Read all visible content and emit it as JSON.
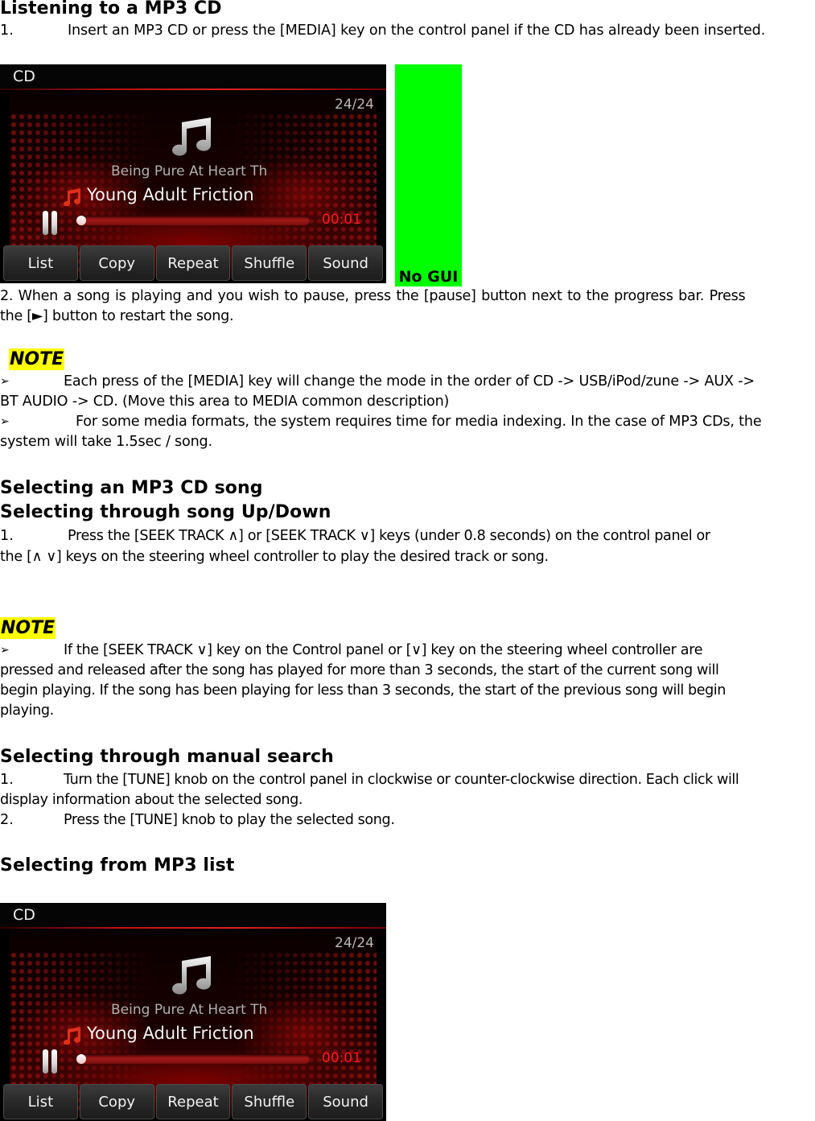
{
  "section1": {
    "heading": "Listening to a MP3 CD",
    "step1_num": "1.",
    "step1_text": "Insert an MP3 CD or press the [MEDIA] key on the control panel if the CD has already been inserted."
  },
  "screen": {
    "source_label": "CD",
    "track_count": "24/24",
    "artist": "Being Pure At Heart Th",
    "title": "Young Adult Friction",
    "elapsed": "00:01",
    "progress_fraction": 0.01,
    "buttons": [
      "List",
      "Copy",
      "Repeat",
      "Shuffle",
      "Sound"
    ],
    "colors": {
      "accent": "#e02020",
      "elapsed_text": "#ff1a1a",
      "note_icon": "#e0301a"
    }
  },
  "placeholder": {
    "label": "No GUI",
    "color": "#00ff00"
  },
  "step2": {
    "line1": "2. When a song is playing and you wish to pause, press the [pause] button next to the progress bar. Press",
    "line2": "the [►] button to restart the song."
  },
  "note1": {
    "label": "NOTE",
    "bullet": "➢",
    "item1_line1": "Each press of the [MEDIA] key will change the mode in the order of CD -> USB/iPod/zune -> AUX ->",
    "item1_line2": "BT AUDIO -> CD. (Move this area to MEDIA common description)",
    "item2_line1": "For some media formats, the system requires time for media indexing. In the case of MP3 CDs, the",
    "item2_line2": "system will take 1.5sec / song."
  },
  "section2": {
    "heading1": "Selecting an MP3 CD song",
    "heading2": "Selecting through song Up/Down",
    "step1_num": "1.",
    "step1_line1": "Press the [SEEK TRACK ∧] or [SEEK TRACK ∨] keys (under 0.8 seconds) on the control panel or",
    "step1_line2": "the [∧ ∨] keys on the steering wheel controller to play the desired track or song."
  },
  "note2": {
    "label": "NOTE",
    "bullet": "➢",
    "line1": "If the [SEEK TRACK ∨] key on the Control panel or [∨] key on the steering wheel controller are",
    "line2": "pressed and released after the song has played for more than 3 seconds, the start of the current song will",
    "line3": "begin playing. If the song has been playing for less than 3 seconds, the start of the previous song will begin",
    "line4": "playing."
  },
  "section3": {
    "heading": "Selecting through manual search",
    "step1_num": "1.",
    "step1_line1": "Turn the [TUNE] knob on the control panel in clockwise or counter-clockwise direction. Each click will",
    "step1_line2": "display information about the selected song.",
    "step2_num": "2.",
    "step2_text": "Press the [TUNE] knob to play the selected song."
  },
  "section4": {
    "heading": "Selecting from MP3 list"
  }
}
